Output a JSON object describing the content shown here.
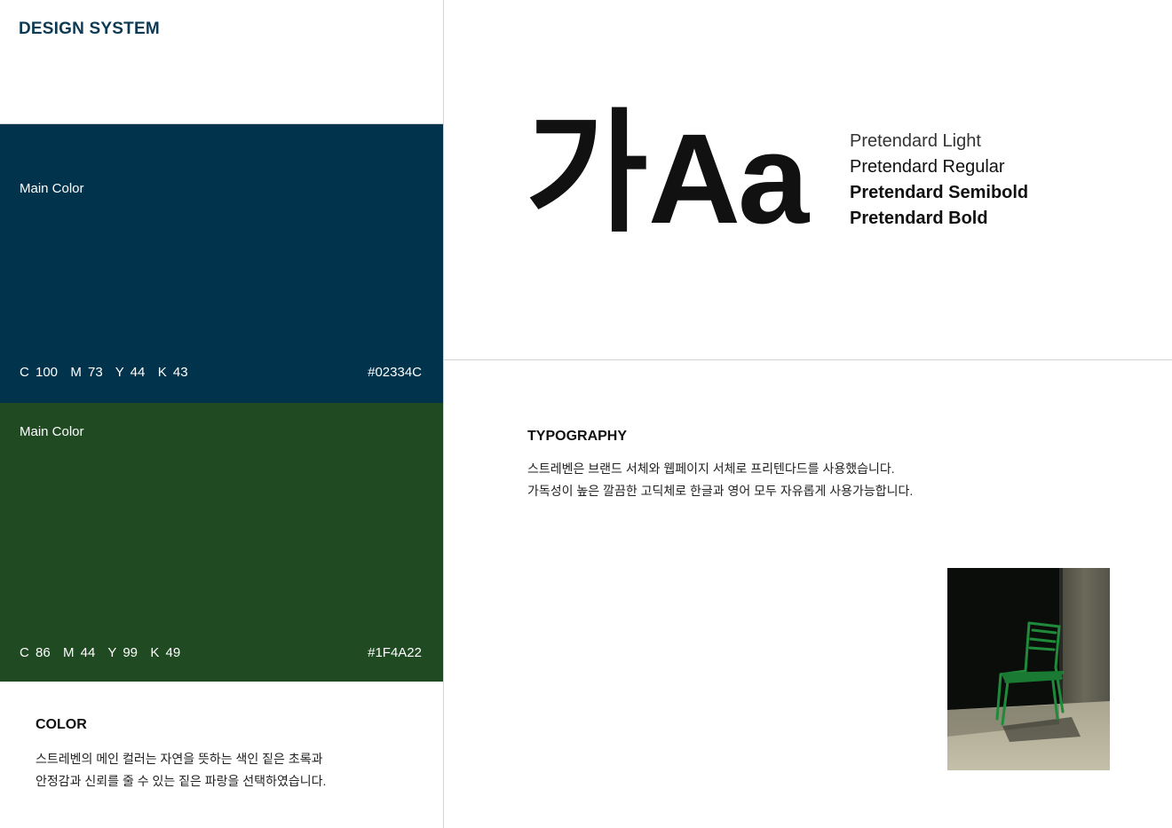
{
  "header": {
    "title": "DESIGN SYSTEM"
  },
  "swatches": [
    {
      "label": "Main Color",
      "cmyk": "C 100  M 73  Y 44  K 43",
      "hex": "#02334C",
      "color": "#02334C"
    },
    {
      "label": "Main Color",
      "cmyk": "C 86  M 44  Y 99  K 49",
      "hex": "#1F4A22",
      "color": "#1F4A22"
    }
  ],
  "color_section": {
    "heading": "COLOR",
    "lines": [
      "스트레벤의 메인 컬러는 자연을 뜻하는 색인 짙은 초록과",
      "안정감과 신뢰를 줄 수 있는 짙은 파랑을 선택하였습니다."
    ]
  },
  "type_specimen": {
    "korean": "가",
    "latin": "Aa",
    "weights": [
      "Pretendard Light",
      "Pretendard Regular",
      "Pretendard Semibold",
      "Pretendard Bold"
    ]
  },
  "typography_section": {
    "heading": "TYPOGRAPHY",
    "lines": [
      "스트레벤은 브랜드 서체와 웹페이지 서체로  프리텐다드를 사용했습니다.",
      "가독성이 높은 깔끔한 고딕체로 한글과 영어 모두 자유롭게 사용가능합니다."
    ]
  },
  "photo": {
    "subject": "green-metal-chair",
    "accent": "#1f8a3a"
  }
}
